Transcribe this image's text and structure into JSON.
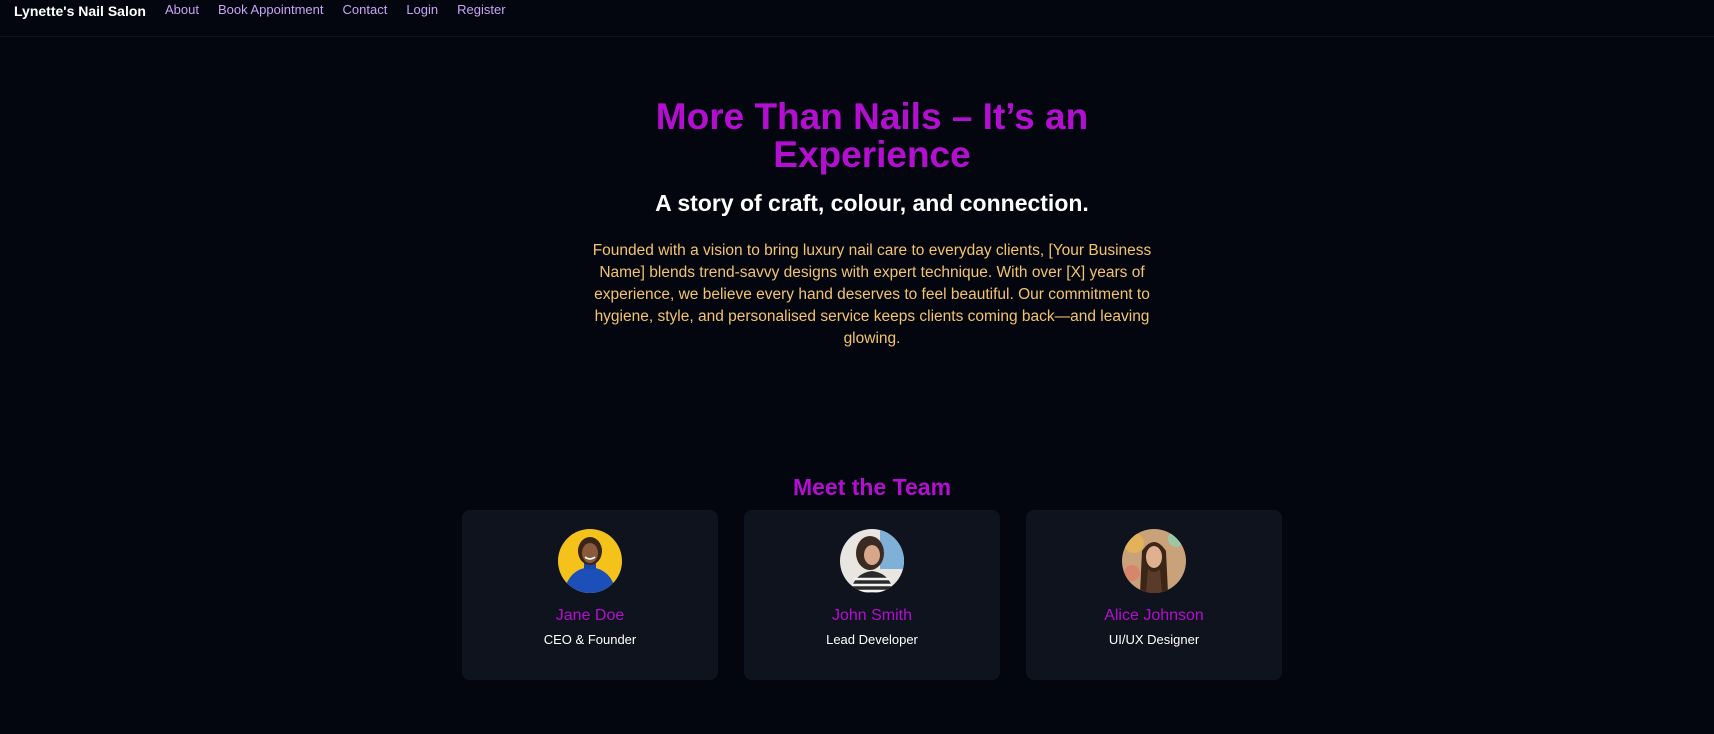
{
  "nav": {
    "brand": "Lynette's Nail Salon",
    "links": [
      {
        "label": "About"
      },
      {
        "label": "Book Appointment"
      },
      {
        "label": "Contact"
      },
      {
        "label": "Login"
      },
      {
        "label": "Register"
      }
    ]
  },
  "hero": {
    "title": "More Than Nails – It’s an Experience",
    "subtitle": "A story of craft, colour, and connection.",
    "body": "Founded with a vision to bring luxury nail care to everyday clients, [Your Business Name] blends trend-savvy designs with expert technique. With over [X] years of experience, we believe every hand deserves to feel beautiful. Our commitment to hygiene, style, and personalised service keeps clients coming back—and leaving glowing."
  },
  "team": {
    "heading": "Meet the Team",
    "members": [
      {
        "name": "Jane Doe",
        "role": "CEO & Founder"
      },
      {
        "name": "John Smith",
        "role": "Lead Developer"
      },
      {
        "name": "Alice Johnson",
        "role": "UI/UX Designer"
      }
    ]
  },
  "colors": {
    "background": "#03060f",
    "accent": "#b40fd0",
    "nav_link": "#c9a2f5",
    "body_text": "#f4c46a",
    "card": "#0f131e"
  }
}
